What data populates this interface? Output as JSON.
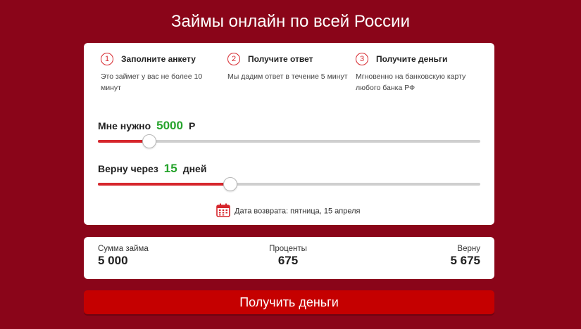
{
  "title": "Займы онлайн по всей России",
  "steps": [
    {
      "num": "1",
      "title": "Заполните анкету",
      "desc": "Это займет у вас не более 10 минут"
    },
    {
      "num": "2",
      "title": "Получите ответ",
      "desc": "Мы дадим ответ в течение 5 минут"
    },
    {
      "num": "3",
      "title": "Получите деньги",
      "desc": "Мгновенно на банковскую карту любого банка РФ"
    }
  ],
  "amount_slider": {
    "label": "Мне нужно",
    "value": "5000",
    "unit": "Р",
    "fill_fraction": 0.133
  },
  "term_slider": {
    "label": "Верну через",
    "value": "15",
    "unit": "дней",
    "fill_fraction": 0.345
  },
  "return_date": "Дата возврата: пятница, 15 апреля",
  "summary": {
    "amount_label": "Сумма займа",
    "amount_value": "5 000",
    "percent_label": "Проценты",
    "percent_value": "675",
    "return_label": "Верну",
    "return_value": "5 675"
  },
  "cta_label": "Получить деньги",
  "colors": {
    "background": "#8a0519",
    "accent": "#d6262c",
    "value_green": "#26a32c",
    "button": "#c50000"
  }
}
